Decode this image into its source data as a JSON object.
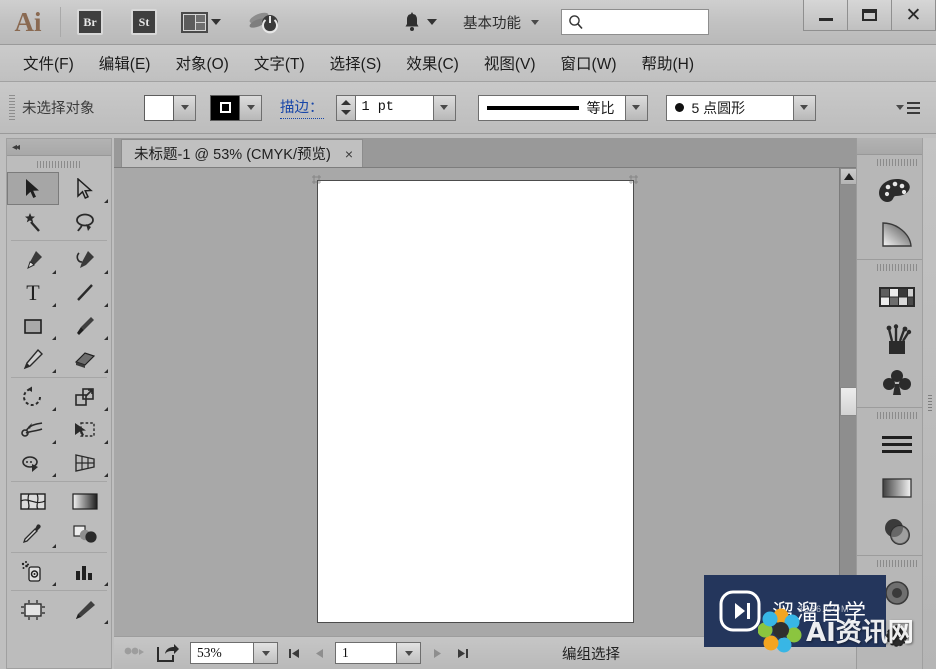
{
  "app": {
    "logo": "Ai",
    "quick_apps": [
      {
        "name": "bridge",
        "label": "Br"
      },
      {
        "name": "stock",
        "label": "St"
      }
    ],
    "arrange_documents": "arrange-documents",
    "workspace_label": "基本功能",
    "search_placeholder": "",
    "search_value": "",
    "window_buttons": {
      "minimize": "–",
      "maximize": "□",
      "close": "✕"
    }
  },
  "menubar": {
    "items": [
      "文件(F)",
      "编辑(E)",
      "对象(O)",
      "文字(T)",
      "选择(S)",
      "效果(C)",
      "视图(V)",
      "窗口(W)",
      "帮助(H)"
    ]
  },
  "controlbar": {
    "selection_label": "未选择对象",
    "fill_swatch": "#ffffff",
    "stroke_swatch": "#000000",
    "stroke_label": "描边：",
    "stroke_weight": "1 pt",
    "stroke_profile": "等比",
    "brush_definition": "5 点圆形",
    "panel_menu": "panel-menu"
  },
  "document": {
    "tab_title": "未标题-1 @ 53% (CMYK/预览)",
    "tab_close": "×",
    "artboard_fill": "#ffffff"
  },
  "statusbar": {
    "zoom_value": "53%",
    "page_value": "1",
    "status_text": "编组选择"
  },
  "toolbar": {
    "collapse": "◂◂",
    "tools": [
      {
        "name": "selection-tool",
        "label": "选择工具",
        "selected": true,
        "more": false
      },
      {
        "name": "direct-selection-tool",
        "label": "直接选择工具",
        "selected": false,
        "more": true
      },
      {
        "name": "magic-wand-tool",
        "label": "魔棒工具",
        "selected": false,
        "more": false
      },
      {
        "name": "lasso-tool",
        "label": "套索工具",
        "selected": false,
        "more": false
      },
      {
        "name": "pen-tool",
        "label": "钢笔工具",
        "selected": false,
        "more": true
      },
      {
        "name": "curvature-tool",
        "label": "曲率工具",
        "selected": false,
        "more": true
      },
      {
        "name": "type-tool",
        "label": "文字工具",
        "selected": false,
        "more": true
      },
      {
        "name": "line-segment-tool",
        "label": "直线段工具",
        "selected": false,
        "more": true
      },
      {
        "name": "rectangle-tool",
        "label": "矩形工具",
        "selected": false,
        "more": true
      },
      {
        "name": "paintbrush-tool",
        "label": "画笔工具",
        "selected": false,
        "more": true
      },
      {
        "name": "pencil-tool",
        "label": "铅笔工具",
        "selected": false,
        "more": true
      },
      {
        "name": "eraser-tool",
        "label": "橡皮擦工具",
        "selected": false,
        "more": true
      },
      {
        "name": "rotate-tool",
        "label": "旋转工具",
        "selected": false,
        "more": true
      },
      {
        "name": "scale-tool",
        "label": "比例缩放工具",
        "selected": false,
        "more": true
      },
      {
        "name": "width-tool",
        "label": "宽度工具",
        "selected": false,
        "more": true
      },
      {
        "name": "free-transform-tool",
        "label": "自由变换工具",
        "selected": false,
        "more": true
      },
      {
        "name": "shape-builder-tool",
        "label": "形状生成器工具",
        "selected": false,
        "more": true
      },
      {
        "name": "perspective-grid-tool",
        "label": "透视网格工具",
        "selected": false,
        "more": true
      },
      {
        "name": "mesh-tool",
        "label": "网格工具",
        "selected": false,
        "more": false
      },
      {
        "name": "gradient-tool",
        "label": "渐变工具",
        "selected": false,
        "more": false
      },
      {
        "name": "eyedropper-tool",
        "label": "吸管工具",
        "selected": false,
        "more": true
      },
      {
        "name": "blend-tool",
        "label": "混合工具",
        "selected": false,
        "more": false
      },
      {
        "name": "symbol-sprayer-tool",
        "label": "符号喷枪工具",
        "selected": false,
        "more": true
      },
      {
        "name": "column-graph-tool",
        "label": "柱形图工具",
        "selected": false,
        "more": true
      },
      {
        "name": "artboard-tool",
        "label": "画板工具",
        "selected": false,
        "more": false
      },
      {
        "name": "slice-tool",
        "label": "切片工具",
        "selected": false,
        "more": true
      }
    ]
  },
  "rightdock": {
    "collapse": "▸▸",
    "groups": [
      {
        "name": "color-group",
        "icons": [
          {
            "name": "color-icon",
            "label": "颜色"
          },
          {
            "name": "gradient-icon",
            "label": "渐变"
          }
        ]
      },
      {
        "name": "swatches-group",
        "icons": [
          {
            "name": "swatches-icon",
            "label": "色板"
          },
          {
            "name": "brushes-icon",
            "label": "画笔"
          },
          {
            "name": "symbols-icon",
            "label": "符号"
          }
        ]
      },
      {
        "name": "stroke-group",
        "icons": [
          {
            "name": "stroke-icon",
            "label": "描边"
          },
          {
            "name": "gradient2-icon",
            "label": "渐变"
          },
          {
            "name": "transparency-icon",
            "label": "透明度"
          }
        ]
      },
      {
        "name": "appearance-group",
        "icons": [
          {
            "name": "appearance-icon",
            "label": "外观"
          },
          {
            "name": "effects-icon",
            "label": "效果"
          }
        ]
      }
    ]
  },
  "watermark": {
    "brand": "溜溜自学",
    "site": "AI资讯网",
    "url": "3366.COM"
  }
}
